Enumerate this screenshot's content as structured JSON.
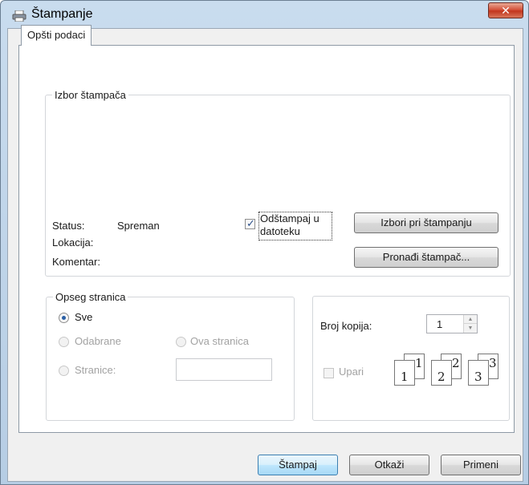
{
  "window": {
    "title": "Štampanje",
    "close_icon": "close-icon"
  },
  "tabs": [
    {
      "label": "Opšti podaci"
    }
  ],
  "printer": {
    "group_label": "Izbor štampača",
    "status_label": "Status:",
    "status_value": "Spreman",
    "location_label": "Lokacija:",
    "comment_label": "Komentar:",
    "print_to_file_line1": "Odštampaj u",
    "print_to_file_line2": "datoteku",
    "print_to_file_checked": true,
    "preferences_button": "Izbori pri štampanju",
    "find_printer_button": "Pronađi štampač..."
  },
  "page_range": {
    "group_label": "Opseg stranica",
    "all_label": "Sve",
    "selection_label": "Odabrane",
    "current_page_label": "Ova stranica",
    "pages_label": "Stranice:",
    "pages_value": ""
  },
  "copies": {
    "count_label": "Broj kopija:",
    "count_value": "1",
    "collate_label": "Upari",
    "collate_checked": false
  },
  "buttons": {
    "print": "Štampaj",
    "cancel": "Otkaži",
    "apply": "Primeni"
  }
}
